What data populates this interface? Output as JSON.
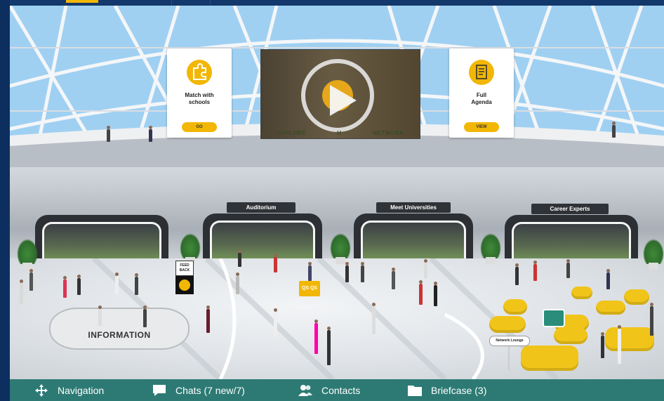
{
  "cards": {
    "match": {
      "title_line1": "Match with",
      "title_line2": "schools",
      "button": "GO",
      "icon": "puzzle-icon"
    },
    "agenda": {
      "title_line1": "Full",
      "title_line2": "Agenda",
      "button": "VIEW",
      "icon": "document-icon"
    }
  },
  "video": {
    "strip": [
      "EXPLORE",
      "H",
      "NETWORK"
    ],
    "icon": "play-icon"
  },
  "halls": {
    "auditorium": "Auditorium",
    "universities": "Meet Universities",
    "experts": "Career Experts"
  },
  "lobby": {
    "information": "INFORMATION",
    "feedback_line1": "FEED",
    "feedback_line2": "BACK",
    "cube": "QS QS",
    "network_lounge": "Network Lounge"
  },
  "bottom_nav": {
    "navigation": {
      "label": "Navigation",
      "icon": "move-arrows-icon"
    },
    "chats": {
      "label": "Chats (7 new/7)",
      "icon": "chat-bubble-icon"
    },
    "contacts": {
      "label": "Contacts",
      "icon": "contacts-icon"
    },
    "briefcase": {
      "label": "Briefcase (3)",
      "icon": "folder-icon"
    }
  },
  "colors": {
    "accent": "#f2b705",
    "bottom_bar": "#2d7a74",
    "frame": "#0c2f5f"
  }
}
